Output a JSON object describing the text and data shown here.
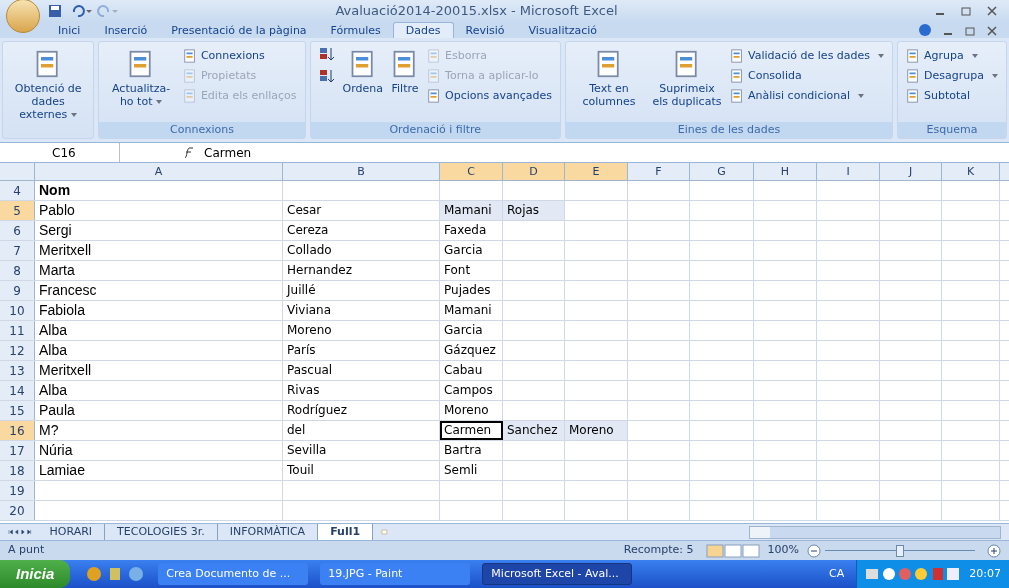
{
  "window": {
    "title": "Avaluació2014-20015.xlsx - Microsoft Excel"
  },
  "tabs": [
    {
      "label": "Inici",
      "selected": false
    },
    {
      "label": "Inserció",
      "selected": false
    },
    {
      "label": "Presentació de la pàgina",
      "selected": false
    },
    {
      "label": "Fórmules",
      "selected": false
    },
    {
      "label": "Dades",
      "selected": true
    },
    {
      "label": "Revisió",
      "selected": false
    },
    {
      "label": "Visualització",
      "selected": false
    }
  ],
  "ribbon": [
    {
      "items": [
        {
          "kind": "large",
          "label": "Obtenció de dades externes",
          "dropdown": true,
          "disabled": false
        }
      ]
    },
    {
      "label": "Connexions",
      "items": [
        {
          "kind": "large",
          "label": "Actualitza-ho tot",
          "dropdown": true,
          "disabled": false
        },
        {
          "kind": "small",
          "label": "Connexions",
          "dropdown": false,
          "disabled": false
        },
        {
          "kind": "small",
          "label": "Propietats",
          "dropdown": false,
          "disabled": true
        },
        {
          "kind": "small",
          "label": "Edita els enllaços",
          "dropdown": false,
          "disabled": true
        }
      ]
    },
    {
      "label": "Ordenació i filtre",
      "items": [
        {
          "kind": "sort"
        },
        {
          "kind": "large",
          "label": "Ordena",
          "dropdown": false,
          "disabled": false
        },
        {
          "kind": "large",
          "label": "Filtre",
          "dropdown": false,
          "disabled": false
        },
        {
          "kind": "small",
          "label": "Esborra",
          "dropdown": false,
          "disabled": true
        },
        {
          "kind": "small",
          "label": "Torna a aplicar-lo",
          "dropdown": false,
          "disabled": true
        },
        {
          "kind": "small",
          "label": "Opcions avançades",
          "dropdown": false,
          "disabled": false
        }
      ]
    },
    {
      "label": "Eines de les dades",
      "items": [
        {
          "kind": "large",
          "label": "Text en columnes",
          "dropdown": false,
          "disabled": false
        },
        {
          "kind": "large",
          "label": "Suprimeix els duplicats",
          "dropdown": false,
          "disabled": false
        },
        {
          "kind": "small",
          "label": "Validació de les dades",
          "dropdown": true,
          "disabled": false
        },
        {
          "kind": "small",
          "label": "Consolida",
          "dropdown": false,
          "disabled": false
        },
        {
          "kind": "small",
          "label": "Anàlisi condicional",
          "dropdown": true,
          "disabled": false
        }
      ]
    },
    {
      "label": "Esquema",
      "items": [
        {
          "kind": "small",
          "label": "Agrupa",
          "dropdown": true,
          "disabled": false
        },
        {
          "kind": "small",
          "label": "Desagrupa",
          "dropdown": true,
          "disabled": false
        },
        {
          "kind": "small",
          "label": "Subtotal",
          "dropdown": false,
          "disabled": false
        }
      ]
    }
  ],
  "formula_bar": {
    "name_box": "C16",
    "value": "Carmen"
  },
  "columns": [
    {
      "label": "A",
      "selected": false
    },
    {
      "label": "B",
      "selected": false
    },
    {
      "label": "C",
      "selected": true
    },
    {
      "label": "D",
      "selected": true
    },
    {
      "label": "E",
      "selected": true
    },
    {
      "label": "F",
      "selected": false
    },
    {
      "label": "G",
      "selected": false
    },
    {
      "label": "H",
      "selected": false
    },
    {
      "label": "I",
      "selected": false
    },
    {
      "label": "J",
      "selected": false
    },
    {
      "label": "K",
      "selected": false
    }
  ],
  "header_row": {
    "number": "4",
    "selected": false,
    "cells": [
      {
        "text": "Nom",
        "selected": false,
        "active": false
      }
    ]
  },
  "rows": [
    {
      "number": "5",
      "selected": true,
      "cells": [
        {
          "text": "Pablo",
          "selected": false,
          "active": false
        },
        {
          "text": "Cesar",
          "selected": false,
          "active": false
        },
        {
          "text": "Mamani",
          "selected": true,
          "active": false
        },
        {
          "text": "Rojas",
          "selected": true,
          "active": false
        }
      ]
    },
    {
      "number": "6",
      "selected": false,
      "cells": [
        {
          "text": "Sergi",
          "selected": false,
          "active": false
        },
        {
          "text": "Cereza",
          "selected": false,
          "active": false
        },
        {
          "text": "Faxeda",
          "selected": false,
          "active": false
        }
      ]
    },
    {
      "number": "7",
      "selected": false,
      "cells": [
        {
          "text": "Meritxell",
          "selected": false,
          "active": false
        },
        {
          "text": "Collado",
          "selected": false,
          "active": false
        },
        {
          "text": "Garcia",
          "selected": false,
          "active": false
        }
      ]
    },
    {
      "number": "8",
      "selected": false,
      "cells": [
        {
          "text": "Marta",
          "selected": false,
          "active": false
        },
        {
          "text": "Hernandez",
          "selected": false,
          "active": false
        },
        {
          "text": "Font",
          "selected": false,
          "active": false
        }
      ]
    },
    {
      "number": "9",
      "selected": false,
      "cells": [
        {
          "text": "Francesc",
          "selected": false,
          "active": false
        },
        {
          "text": "Juillé",
          "selected": false,
          "active": false
        },
        {
          "text": "Pujades",
          "selected": false,
          "active": false
        }
      ]
    },
    {
      "number": "10",
      "selected": false,
      "cells": [
        {
          "text": "Fabiola",
          "selected": false,
          "active": false
        },
        {
          "text": "Viviana",
          "selected": false,
          "active": false
        },
        {
          "text": "Mamani",
          "selected": false,
          "active": false
        }
      ]
    },
    {
      "number": "11",
      "selected": false,
      "cells": [
        {
          "text": "Alba",
          "selected": false,
          "active": false
        },
        {
          "text": "Moreno",
          "selected": false,
          "active": false
        },
        {
          "text": "Garcia",
          "selected": false,
          "active": false
        }
      ]
    },
    {
      "number": "12",
      "selected": false,
      "cells": [
        {
          "text": "Alba",
          "selected": false,
          "active": false
        },
        {
          "text": "París",
          "selected": false,
          "active": false
        },
        {
          "text": "Gázquez",
          "selected": false,
          "active": false
        }
      ]
    },
    {
      "number": "13",
      "selected": false,
      "cells": [
        {
          "text": "Meritxell",
          "selected": false,
          "active": false
        },
        {
          "text": "Pascual",
          "selected": false,
          "active": false
        },
        {
          "text": "Cabau",
          "selected": false,
          "active": false
        }
      ]
    },
    {
      "number": "14",
      "selected": false,
      "cells": [
        {
          "text": "Alba",
          "selected": false,
          "active": false
        },
        {
          "text": "Rivas",
          "selected": false,
          "active": false
        },
        {
          "text": "Campos",
          "selected": false,
          "active": false
        }
      ]
    },
    {
      "number": "15",
      "selected": false,
      "cells": [
        {
          "text": "Paula",
          "selected": false,
          "active": false
        },
        {
          "text": "Rodríguez",
          "selected": false,
          "active": false
        },
        {
          "text": "Moreno",
          "selected": false,
          "active": false
        }
      ]
    },
    {
      "number": "16",
      "selected": true,
      "cells": [
        {
          "text": "M?",
          "selected": false,
          "active": false
        },
        {
          "text": "del",
          "selected": false,
          "active": false
        },
        {
          "text": "Carmen",
          "selected": true,
          "active": true
        },
        {
          "text": "Sanchez",
          "selected": true,
          "active": false
        },
        {
          "text": "Moreno",
          "selected": true,
          "active": false
        }
      ]
    },
    {
      "number": "17",
      "selected": false,
      "cells": [
        {
          "text": "Núria",
          "selected": false,
          "active": false
        },
        {
          "text": "Sevilla",
          "selected": false,
          "active": false
        },
        {
          "text": "Bartra",
          "selected": false,
          "active": false
        }
      ]
    },
    {
      "number": "18",
      "selected": false,
      "cells": [
        {
          "text": "Lamiae",
          "selected": false,
          "active": false
        },
        {
          "text": "Touil",
          "selected": false,
          "active": false
        },
        {
          "text": "Semli",
          "selected": false,
          "active": false
        }
      ]
    },
    {
      "number": "19",
      "selected": false,
      "cells": []
    },
    {
      "number": "20",
      "selected": false,
      "cells": []
    }
  ],
  "sheet_tabs": [
    {
      "label": "HORARI",
      "selected": false
    },
    {
      "label": "TECOLOGIES 3r.",
      "selected": false
    },
    {
      "label": "INFORMÀTICA",
      "selected": false
    },
    {
      "label": "Full1",
      "selected": true
    }
  ],
  "status_bar": {
    "state": "A punt",
    "count": "Recompte: 5",
    "zoom": "100%",
    "zoom_level": {
      "level": 0.5
    }
  },
  "taskbar": {
    "start": "Inicia",
    "tasks": [
      {
        "label": "Crea Documento de ...",
        "selected": false
      },
      {
        "label": "19.JPG - Paint",
        "selected": false
      },
      {
        "label": "Microsoft Excel - Aval...",
        "selected": true
      }
    ],
    "language": "CA",
    "clock": "20:07"
  }
}
